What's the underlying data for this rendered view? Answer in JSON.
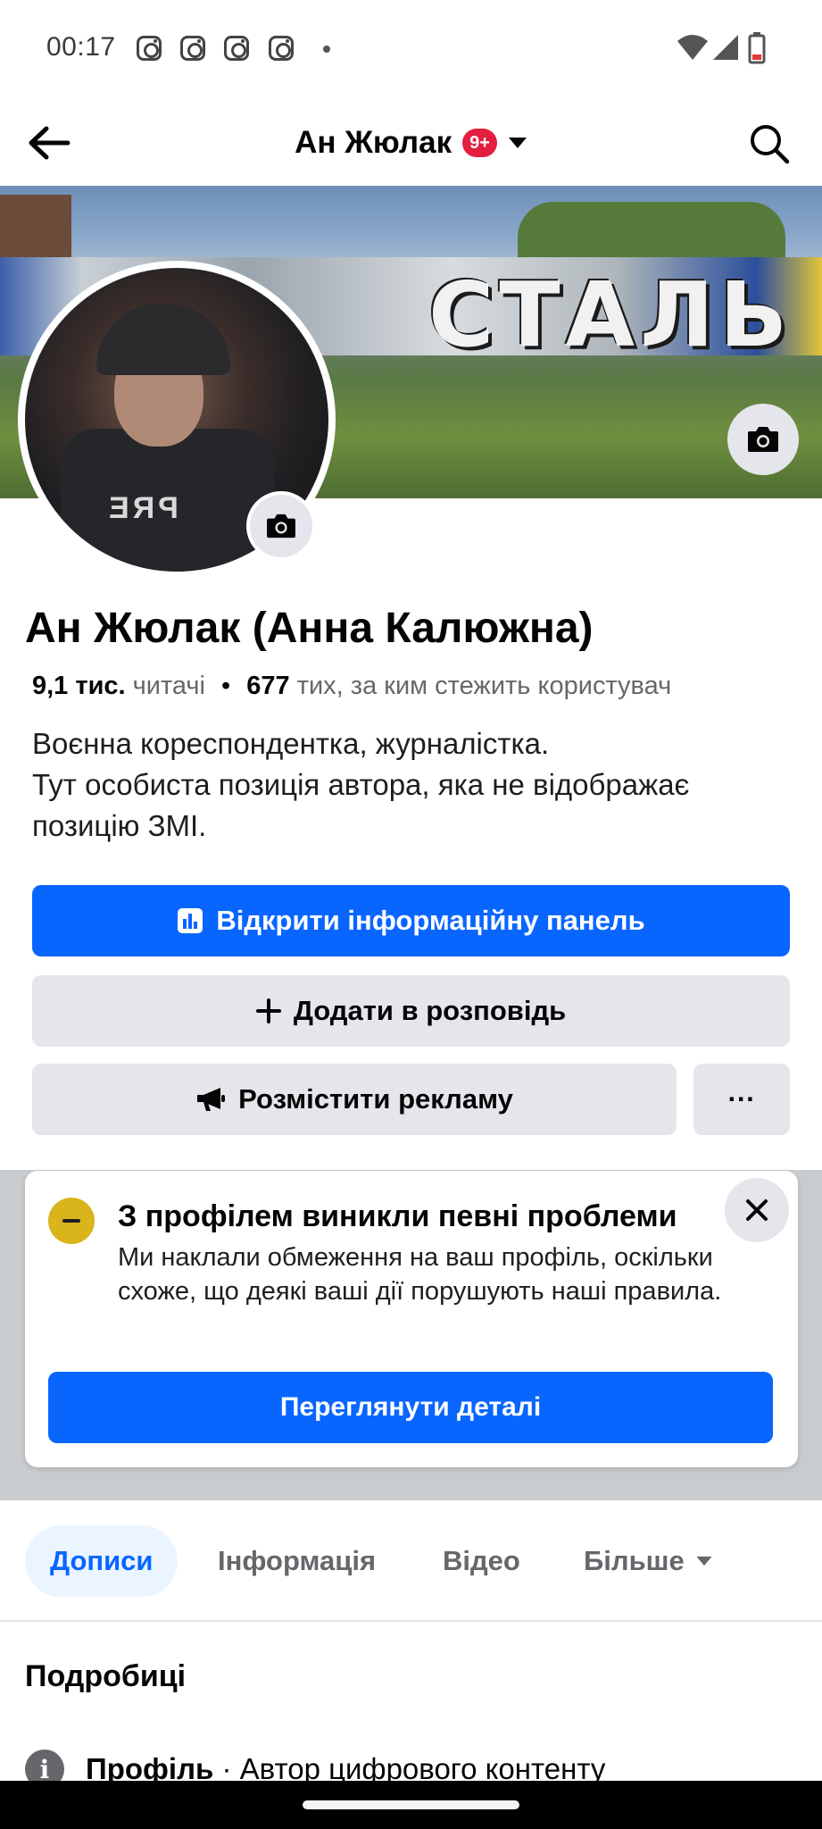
{
  "status_bar": {
    "time": "00:17",
    "notification_icons": [
      "instagram-icon",
      "instagram-icon",
      "instagram-icon",
      "instagram-icon"
    ],
    "right_icons": [
      "wifi-icon",
      "signal-icon",
      "battery-low-icon"
    ]
  },
  "header": {
    "title": "Ан Жюлак",
    "badge": "9+",
    "back_icon": "arrow-left-icon",
    "search_icon": "search-icon"
  },
  "cover": {
    "graffiti_text": "СТАЛЬ"
  },
  "avatar": {
    "vest_text": "PRE"
  },
  "profile": {
    "name": "Ан Жюлак (Анна Калюжна)",
    "followers_count": "9,1 тис.",
    "followers_label": "читачі",
    "separator": "•",
    "following_count": "677",
    "following_label": "тих, за ким стежить користувач",
    "bio_line1": "Воєнна кореспондентка, журналістка.",
    "bio_line2": "Тут особиста позиція автора, яка не відображає позицію ЗМІ."
  },
  "actions": {
    "dashboard_label": "Відкрити інформаційну панель",
    "story_label": "Додати в розповідь",
    "ads_label": "Розмістити рекламу",
    "more_label": "···"
  },
  "warning": {
    "title": "З профілем виникли певні проблеми",
    "text": "Ми наклали обмеження на ваш профіль, оскільки схоже, що деякі ваші дії порушують наші правила.",
    "button_label": "Переглянути деталі",
    "accent_color": "#d9b41b"
  },
  "tabs": [
    {
      "label": "Дописи",
      "active": true
    },
    {
      "label": "Інформація",
      "active": false
    },
    {
      "label": "Відео",
      "active": false
    },
    {
      "label": "Більше",
      "active": false
    }
  ],
  "details": {
    "title": "Подробиці",
    "row_label": "Профіль",
    "row_value": " · Автор цифрового контенту"
  },
  "colors": {
    "primary": "#0866ff",
    "secondary_bg": "#e4e6eb",
    "text": "#050505",
    "muted": "#65676b",
    "badge": "#e41e3f"
  }
}
